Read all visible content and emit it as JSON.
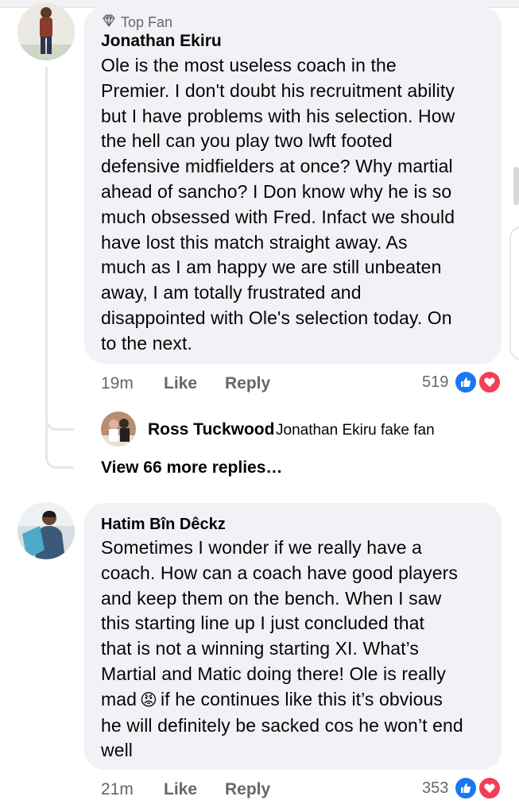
{
  "comments": [
    {
      "badge": "Top Fan",
      "badge_icon": "diamond-icon",
      "author": "Jonathan Ekiru",
      "text_lines": [
        "Ole is the most useless coach in the",
        "Premier. I don't doubt his recruitment ability",
        "but I have problems with his selection. How",
        "the hell can you play two lwft footed",
        "defensive midfielders at once? Why martial",
        "ahead of sancho? I Don know why he is so",
        "much obsessed with Fred. Infact we should",
        "have lost this match straight away. As",
        "much as I am happy we are still unbeaten",
        "away, I am totally frustrated and",
        "disappointed with Ole's selection today. On",
        "to the next."
      ],
      "time": "19m",
      "like_label": "Like",
      "reply_label": "Reply",
      "reaction_count": "519",
      "reactions": [
        "like",
        "love"
      ]
    },
    {
      "author": "Hatim Bîn Dêckz",
      "text_lines": [
        "Sometimes I wonder if we really have a",
        "coach. How can a coach have good players",
        "and keep them on the bench. When I saw",
        "this starting line up I just concluded that",
        "that is not a winning starting XI. What’s",
        "Martial and Matic doing there! Ole is really",
        "mad",
        "if he continues like this it’s obvious",
        "he will definitely be sacked cos he won’t end",
        "well"
      ],
      "emoji": "😡",
      "time": "21m",
      "like_label": "Like",
      "reply_label": "Reply",
      "reaction_count": "353",
      "reactions": [
        "like",
        "love"
      ]
    }
  ],
  "reply": {
    "author": "Ross Tuckwood",
    "text": "Jonathan Ekiru fake fan"
  },
  "view_more": "View 66 more replies…",
  "colors": {
    "bubble": "#f0f2f5",
    "like_blue": "#1877f2",
    "love_red": "#f33e58",
    "secondary_text": "#65676b"
  }
}
